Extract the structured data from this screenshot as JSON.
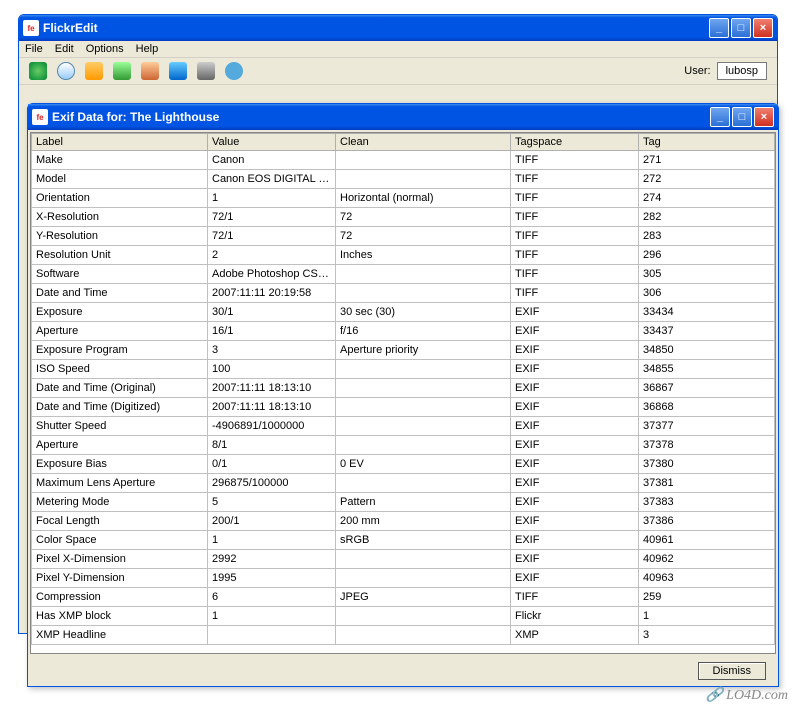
{
  "main": {
    "title": "FlickrEdit",
    "menus": [
      "File",
      "Edit",
      "Options",
      "Help"
    ],
    "user_label": "User:",
    "user_value": "lubosp"
  },
  "dialog": {
    "title": "Exif Data for: The Lighthouse",
    "columns": [
      "Label",
      "Value",
      "Clean",
      "Tagspace",
      "Tag"
    ],
    "rows": [
      {
        "label": "Make",
        "value": "Canon",
        "clean": "",
        "tagspace": "TIFF",
        "tag": "271"
      },
      {
        "label": "Model",
        "value": "Canon EOS DIGITAL R...",
        "clean": "",
        "tagspace": "TIFF",
        "tag": "272"
      },
      {
        "label": "Orientation",
        "value": "1",
        "clean": "Horizontal (normal)",
        "tagspace": "TIFF",
        "tag": "274"
      },
      {
        "label": "X-Resolution",
        "value": "72/1",
        "clean": "72",
        "tagspace": "TIFF",
        "tag": "282"
      },
      {
        "label": "Y-Resolution",
        "value": "72/1",
        "clean": "72",
        "tagspace": "TIFF",
        "tag": "283"
      },
      {
        "label": "Resolution Unit",
        "value": "2",
        "clean": "Inches",
        "tagspace": "TIFF",
        "tag": "296"
      },
      {
        "label": "Software",
        "value": "Adobe Photoshop CS3 ...",
        "clean": "",
        "tagspace": "TIFF",
        "tag": "305"
      },
      {
        "label": "Date and Time",
        "value": "2007:11:11 20:19:58",
        "clean": "",
        "tagspace": "TIFF",
        "tag": "306"
      },
      {
        "label": "Exposure",
        "value": "30/1",
        "clean": "30 sec (30)",
        "tagspace": "EXIF",
        "tag": "33434"
      },
      {
        "label": "Aperture",
        "value": "16/1",
        "clean": "f/16",
        "tagspace": "EXIF",
        "tag": "33437"
      },
      {
        "label": "Exposure Program",
        "value": "3",
        "clean": "Aperture priority",
        "tagspace": "EXIF",
        "tag": "34850"
      },
      {
        "label": "ISO Speed",
        "value": "100",
        "clean": "",
        "tagspace": "EXIF",
        "tag": "34855"
      },
      {
        "label": "Date and Time (Original)",
        "value": "2007:11:11 18:13:10",
        "clean": "",
        "tagspace": "EXIF",
        "tag": "36867"
      },
      {
        "label": "Date and Time (Digitized)",
        "value": "2007:11:11 18:13:10",
        "clean": "",
        "tagspace": "EXIF",
        "tag": "36868"
      },
      {
        "label": "Shutter Speed",
        "value": "-4906891/1000000",
        "clean": "",
        "tagspace": "EXIF",
        "tag": "37377"
      },
      {
        "label": "Aperture",
        "value": "8/1",
        "clean": "",
        "tagspace": "EXIF",
        "tag": "37378"
      },
      {
        "label": "Exposure Bias",
        "value": "0/1",
        "clean": "0 EV",
        "tagspace": "EXIF",
        "tag": "37380"
      },
      {
        "label": "Maximum Lens Aperture",
        "value": "296875/100000",
        "clean": "",
        "tagspace": "EXIF",
        "tag": "37381"
      },
      {
        "label": "Metering Mode",
        "value": "5",
        "clean": "Pattern",
        "tagspace": "EXIF",
        "tag": "37383"
      },
      {
        "label": "Focal Length",
        "value": "200/1",
        "clean": "200 mm",
        "tagspace": "EXIF",
        "tag": "37386"
      },
      {
        "label": "Color Space",
        "value": "1",
        "clean": "sRGB",
        "tagspace": "EXIF",
        "tag": "40961"
      },
      {
        "label": "Pixel X-Dimension",
        "value": "2992",
        "clean": "",
        "tagspace": "EXIF",
        "tag": "40962"
      },
      {
        "label": "Pixel Y-Dimension",
        "value": "1995",
        "clean": "",
        "tagspace": "EXIF",
        "tag": "40963"
      },
      {
        "label": "Compression",
        "value": "6",
        "clean": "JPEG",
        "tagspace": "TIFF",
        "tag": "259"
      },
      {
        "label": "Has XMP block",
        "value": "1",
        "clean": "",
        "tagspace": "Flickr",
        "tag": "1"
      },
      {
        "label": "XMP Headline",
        "value": "",
        "clean": "",
        "tagspace": "XMP",
        "tag": "3"
      }
    ],
    "dismiss_label": "Dismiss"
  },
  "watermark": "LO4D.com"
}
